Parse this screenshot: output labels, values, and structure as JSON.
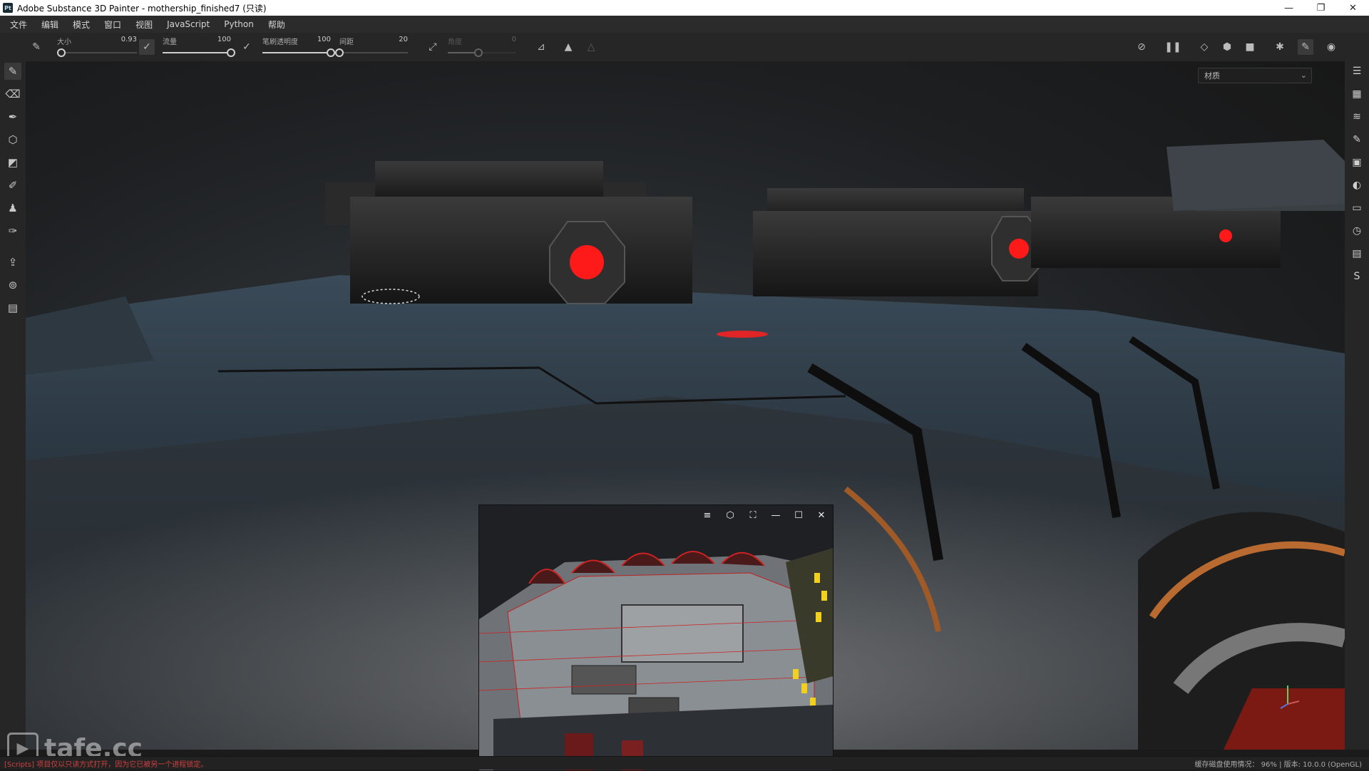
{
  "window": {
    "app_icon": "Pt",
    "title": "Adobe Substance 3D Painter - mothership_finished7 (只读)",
    "controls": [
      "—",
      "❐",
      "✕"
    ]
  },
  "menu": [
    "文件",
    "编辑",
    "模式",
    "窗口",
    "视图",
    "JavaScript",
    "Python",
    "帮助"
  ],
  "toolbar": {
    "size": {
      "label": "大小",
      "value": "0.93",
      "level": 0.05
    },
    "flow": {
      "label": "流量",
      "value": "100",
      "level": 1.0
    },
    "stroke_opacity": {
      "label": "笔刷透明度",
      "value": "100",
      "level": 1.0
    },
    "spacing": {
      "label": "间距",
      "value": "20",
      "level": 0.0
    },
    "angle": {
      "label": "角度",
      "value": "0",
      "level": 0.45
    }
  },
  "viewport": {
    "channel_dropdown": "材质"
  },
  "mini_window": {
    "buttons": [
      "≡",
      "⬡",
      "⛶",
      "—",
      "☐",
      "✕"
    ]
  },
  "status": {
    "message": "[Scripts] 项目仅以只读方式打开，因为它已被另一个进程锁定。",
    "disk_usage_label": "缓存磁盘使用情况：",
    "disk_usage_value": "96%",
    "version": "版本: 10.0.0 (OpenGL)"
  },
  "watermark": "tafe.cc",
  "icons": {
    "left": [
      "paint-brush-icon",
      "eraser-icon",
      "projection-icon",
      "geometry-fill-icon",
      "polygon-fill-icon",
      "smudge-icon",
      "clone-icon",
      "color-picker-icon",
      "bake-icon",
      "material-picker-icon",
      "export-icon"
    ],
    "right": [
      "layers-stack-icon",
      "texture-set-icon",
      "layers-icon",
      "properties-icon",
      "display-settings-icon",
      "shader-settings-icon",
      "texture-list-icon",
      "history-icon",
      "log-icon",
      "substance-icon"
    ]
  },
  "colors": {
    "accent_red": "#ff1a1a",
    "panel": "#262626",
    "status_error": "#d04040"
  }
}
